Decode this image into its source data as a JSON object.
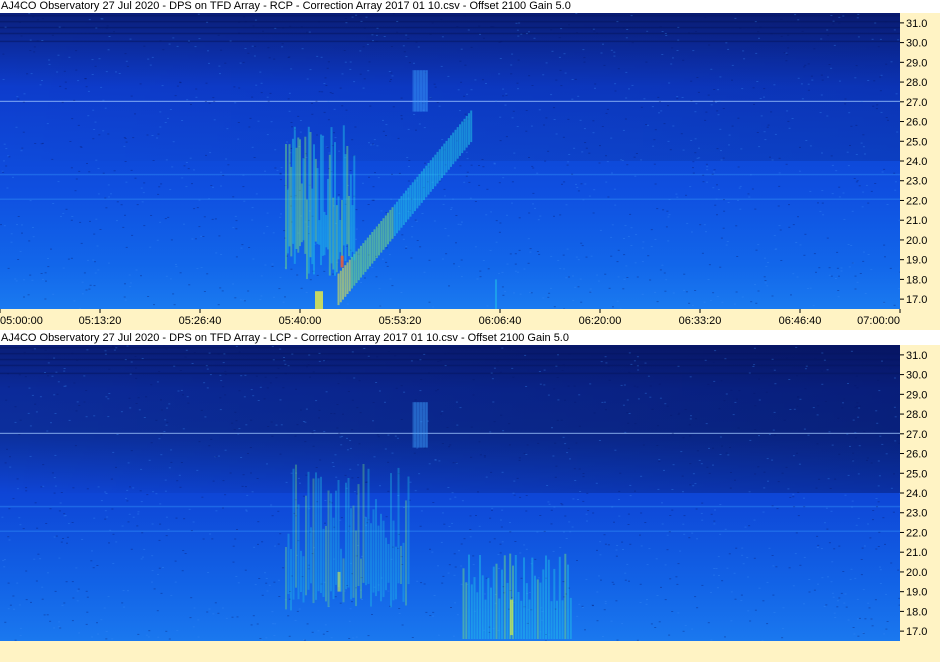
{
  "panels": [
    {
      "id": "rcp",
      "title": "AJ4CO Observatory 27 Jul 2020  -  DPS on TFD Array  -  RCP  -  Correction Array 2017 01 10.csv  -  Offset 2100  Gain 5.0",
      "polarization": "RCP",
      "show_time_axis": true
    },
    {
      "id": "lcp",
      "title": "AJ4CO Observatory 27 Jul 2020  -  DPS on TFD Array  -  LCP  -  Correction Array 2017 01 10.csv  -  Offset 2100  Gain 5.0",
      "polarization": "LCP",
      "show_time_axis": false
    }
  ],
  "chart_data": {
    "type": "heatmap",
    "xlabel": "",
    "ylabel": "",
    "x_tick_labels": [
      "05:00:00",
      "05:13:20",
      "05:26:40",
      "05:40:00",
      "05:53:20",
      "06:06:40",
      "06:20:00",
      "06:33:20",
      "06:46:40",
      "07:00:00"
    ],
    "xlim": [
      "05:00:00",
      "07:00:00"
    ],
    "y_tick_labels": [
      "31.0",
      "30.0",
      "29.0",
      "28.0",
      "27.0",
      "26.0",
      "25.0",
      "24.0",
      "23.0",
      "22.0",
      "21.0",
      "20.0",
      "19.0",
      "18.0",
      "17.0"
    ],
    "ylim": [
      16.5,
      31.5
    ],
    "y_axis_side": "right",
    "colormap": [
      "#0a1a6e",
      "#0b3bd6",
      "#1a78f0",
      "#22c8e8",
      "#7be87a",
      "#f0f040",
      "#f06030"
    ],
    "background_color": "#0f44d8",
    "axis_background": "#fff3c4",
    "events": [
      {
        "panel": "rcp",
        "description_band": "drifting burst",
        "start_time": "05:38:00",
        "end_time": "05:56:00",
        "freq_range": [
          16.5,
          28.0
        ],
        "peak_time": "05:45:20",
        "peak_freq": 18.8
      }
    ]
  }
}
